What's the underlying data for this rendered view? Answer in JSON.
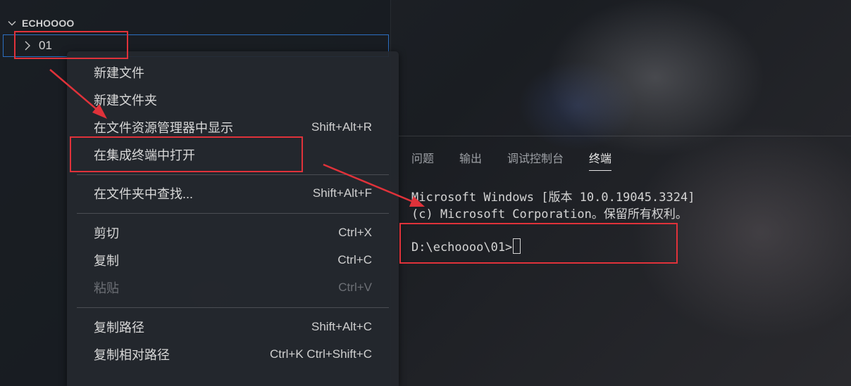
{
  "explorer": {
    "workspace_title": "ECHOOOO",
    "folder_name": "01"
  },
  "context_menu": {
    "items": [
      {
        "label": "新建文件",
        "shortcut": ""
      },
      {
        "label": "新建文件夹",
        "shortcut": ""
      },
      {
        "label": "在文件资源管理器中显示",
        "shortcut": "Shift+Alt+R"
      },
      {
        "label": "在集成终端中打开",
        "shortcut": ""
      },
      {
        "label": "在文件夹中查找...",
        "shortcut": "Shift+Alt+F"
      },
      {
        "label": "剪切",
        "shortcut": "Ctrl+X"
      },
      {
        "label": "复制",
        "shortcut": "Ctrl+C"
      },
      {
        "label": "粘贴",
        "shortcut": "Ctrl+V",
        "disabled": true
      },
      {
        "label": "复制路径",
        "shortcut": "Shift+Alt+C"
      },
      {
        "label": "复制相对路径",
        "shortcut": "Ctrl+K Ctrl+Shift+C"
      }
    ]
  },
  "panel": {
    "tabs": [
      "问题",
      "输出",
      "调试控制台",
      "终端"
    ],
    "active_tab": "终端"
  },
  "terminal": {
    "line1": "Microsoft Windows [版本 10.0.19045.3324]",
    "line2": "(c) Microsoft Corporation。保留所有权利。",
    "prompt": "D:\\echoooo\\01>"
  },
  "colors": {
    "annotation_red": "#e0323a",
    "focus_blue": "#2c6fc2"
  }
}
